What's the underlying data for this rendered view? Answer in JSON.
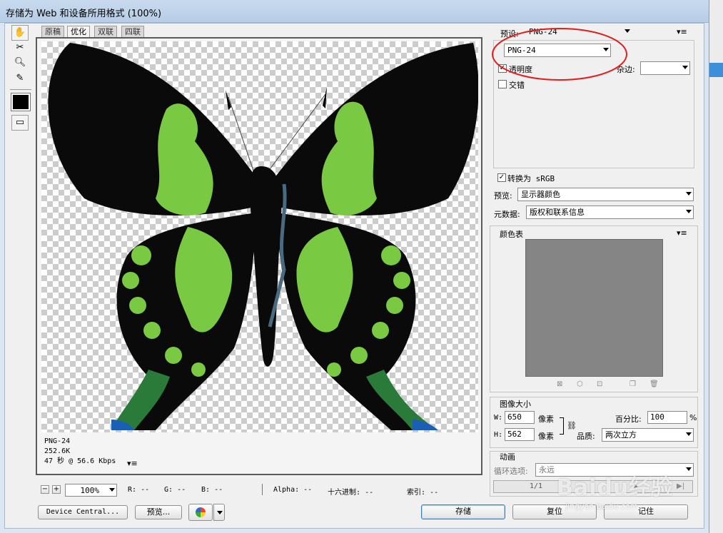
{
  "window": {
    "title": "存储为 Web 和设备所用格式 (100%)"
  },
  "tabs": [
    {
      "label": "原稿"
    },
    {
      "label": "优化"
    },
    {
      "label": "双联"
    },
    {
      "label": "四联"
    }
  ],
  "tools": {
    "hand": "hand-icon",
    "slice_select": "slice-select-icon",
    "zoom": "zoom-icon",
    "eyedropper": "eyedropper-icon",
    "color_swatch": "#000000",
    "toggle_slices": "toggle-slices-icon"
  },
  "preview_info": {
    "format": "PNG-24",
    "size": "252.6K",
    "time": "47 秒 @ 56.6 Kbps",
    "menu": "▾≡"
  },
  "zoom_bar": {
    "minus": "−",
    "plus": "+",
    "zoom": "100%",
    "r_label": "R:",
    "r_value": "--",
    "g_label": "G:",
    "g_value": "--",
    "b_label": "B:",
    "b_value": "--",
    "alpha_label": "Alpha:",
    "alpha_value": "--",
    "hex_label": "十六进制:",
    "hex_value": "--",
    "index_label": "索引:",
    "index_value": "--"
  },
  "bottom_buttons": {
    "device_central": "Device Central...",
    "preview": "预览...",
    "save": "存储",
    "reset": "复位",
    "remember": "记住"
  },
  "settings": {
    "preset_label": "预设:",
    "preset_value": "PNG-24",
    "format_value": "PNG-24",
    "transparency_label": "透明度",
    "transparency_checked": true,
    "matte_label": "杂边:",
    "matte_value": "",
    "interlaced_label": "交错",
    "interlaced_checked": false,
    "srgb_label": "转换为 sRGB",
    "srgb_checked": true,
    "preview_label": "预览:",
    "preview_value": "显示器颜色",
    "metadata_label": "元数据:",
    "metadata_value": "版权和联系信息"
  },
  "color_table": {
    "title": "颜色表",
    "swatch_bg": "#858585",
    "menu": "▾≡"
  },
  "image_size": {
    "title": "图像大小",
    "w_label": "W:",
    "w_value": "650",
    "w_unit": "像素",
    "h_label": "H:",
    "h_value": "562",
    "h_unit": "像素",
    "percent_label": "百分比:",
    "percent_value": "100",
    "percent_unit": "%",
    "quality_label": "品质:",
    "quality_value": "两次立方"
  },
  "animation": {
    "title": "动画",
    "loop_label": "循环选项:",
    "loop_value": "永远",
    "frame_counter": "1/1"
  },
  "annotation": {
    "color": "#e02020"
  },
  "watermark": {
    "brand": "Baidu经验",
    "url": "jingyan.baidu.com"
  }
}
